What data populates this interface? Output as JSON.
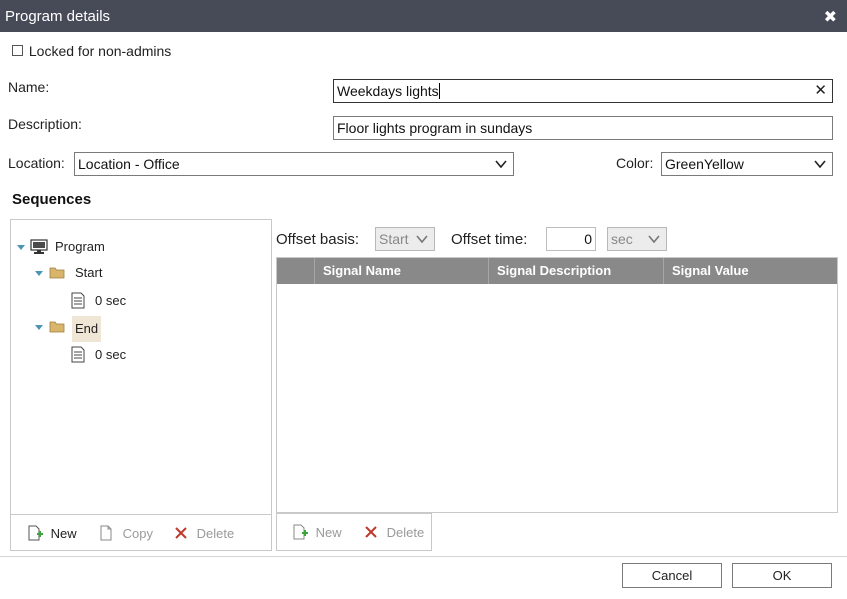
{
  "window": {
    "title": "Program details",
    "close_glyph": "✖"
  },
  "locked": {
    "label": "Locked for non-admins",
    "checked": false
  },
  "name": {
    "label": "Name:",
    "value": "Weekdays lights",
    "clear_glyph": "✕"
  },
  "description": {
    "label": "Description:",
    "value": "Floor lights program in sundays"
  },
  "location": {
    "label": "Location:",
    "value": "Location - Office"
  },
  "color": {
    "label": "Color:",
    "value": "GreenYellow"
  },
  "sequences": {
    "title": "Sequences",
    "tree": {
      "root": "Program",
      "start": {
        "label": "Start",
        "child": "0 sec"
      },
      "end": {
        "label": "End",
        "child": "0 sec"
      }
    },
    "toolbar": {
      "new": "New",
      "copy": "Copy",
      "delete": "Delete"
    }
  },
  "offset": {
    "basis_label": "Offset basis:",
    "basis_value": "Start",
    "time_label": "Offset time:",
    "time_value": "0",
    "unit_value": "sec"
  },
  "signals": {
    "columns": [
      "Signal Name",
      "Signal Description",
      "Signal Value"
    ],
    "rows": [],
    "toolbar": {
      "new": "New",
      "delete": "Delete"
    }
  },
  "footer": {
    "cancel": "Cancel",
    "ok": "OK"
  },
  "colors": {
    "titlebar": "#474b57",
    "grid_header": "#898989",
    "tree_arrow": "#4d93b5",
    "delete_x": "#c0392b",
    "folder": "#d9b56b"
  }
}
